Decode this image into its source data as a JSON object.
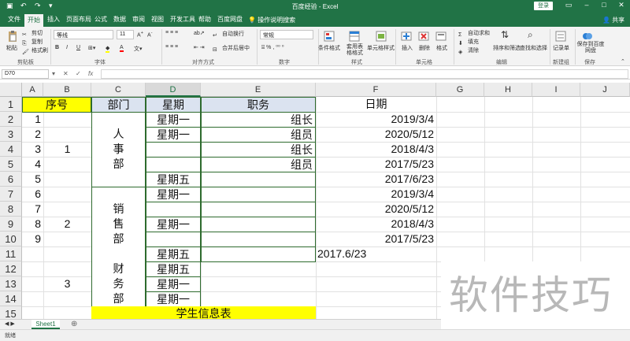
{
  "titlebar": {
    "title": "百度经验 - Excel",
    "login": "登录",
    "save_icon": "save-icon",
    "undo_icon": "undo-icon",
    "redo_icon": "redo-icon"
  },
  "tabs": [
    "文件",
    "开始",
    "插入",
    "页面布局",
    "公式",
    "数据",
    "审阅",
    "视图",
    "开发工具",
    "帮助",
    "百度网盘"
  ],
  "active_tab": "开始",
  "tell_me": "操作说明搜索",
  "share": "共享",
  "ribbon": {
    "clipboard": {
      "paste": "粘贴",
      "cut": "剪切",
      "copy": "复制",
      "format_painter": "格式刷",
      "label": "剪贴板"
    },
    "font": {
      "name": "等线",
      "size": "11",
      "bold": "B",
      "italic": "I",
      "underline": "U",
      "label": "字体",
      "color_a": "A"
    },
    "alignment": {
      "wrap": "自动换行",
      "merge": "合并后居中",
      "label": "对齐方式"
    },
    "number": {
      "format": "常规",
      "label": "数字"
    },
    "styles": {
      "conditional": "条件格式",
      "table": "套用表格格式",
      "cell_styles": "单元格样式",
      "label": "样式"
    },
    "cells": {
      "insert": "插入",
      "delete": "删除",
      "format": "格式",
      "label": "单元格"
    },
    "editing": {
      "autosum": "自动求和",
      "fill": "填充",
      "clear": "清除",
      "sort": "排序和筛选",
      "find": "查找和选择",
      "label": "编辑"
    },
    "new_group": {
      "record": "记录单",
      "label": "新建组"
    },
    "baidu": {
      "save": "保存到百度网盘",
      "label": "保存"
    }
  },
  "formula_bar": {
    "name_box": "D70",
    "fx": "fx",
    "value": ""
  },
  "columns": [
    "A",
    "B",
    "C",
    "D",
    "E",
    "F",
    "G",
    "H",
    "I",
    "J"
  ],
  "rows": [
    "1",
    "2",
    "3",
    "4",
    "5",
    "6",
    "7",
    "8",
    "9",
    "10",
    "11",
    "12",
    "13",
    "14",
    "15"
  ],
  "cells": {
    "a1": "序号",
    "c1": "部门",
    "d1": "星期",
    "e1": "职务",
    "f1": "日期",
    "a_vals": [
      "1",
      "2",
      "3",
      "4",
      "5",
      "6",
      "7",
      "8",
      "9"
    ],
    "b_groups": [
      "1",
      "2",
      "3"
    ],
    "dept": [
      [
        "人",
        "事",
        "部"
      ],
      [
        "销",
        "售",
        "部"
      ],
      [
        "财",
        "务",
        "部"
      ]
    ],
    "d_vals": {
      "r2": "星期一",
      "r3": "星期一",
      "r6": "星期五",
      "r7": "星期一",
      "r9": "星期一",
      "r11": "星期五",
      "r12": "星期五",
      "r13": "星期一",
      "r14": "星期一"
    },
    "e_vals": {
      "r2": "组长",
      "r3": "组员",
      "r4": "组长",
      "r5": "组员"
    },
    "f_vals": {
      "r2": "2019/3/4",
      "r3": "2020/5/12",
      "r4": "2018/4/3",
      "r5": "2017/5/23",
      "r6": "2017/6/23",
      "r7": "2019/3/4",
      "r8": "2020/5/12",
      "r9": "2018/4/3",
      "r10": "2017/5/23"
    },
    "e11": "2017.6/23",
    "merged15": "学生信息表"
  },
  "colors": {
    "excel_green": "#217346",
    "yellow": "#ffff00",
    "header_blue": "#dbe3f0"
  },
  "sheet_tab": "Sheet1",
  "status": "就绪",
  "watermark": "软件技巧"
}
